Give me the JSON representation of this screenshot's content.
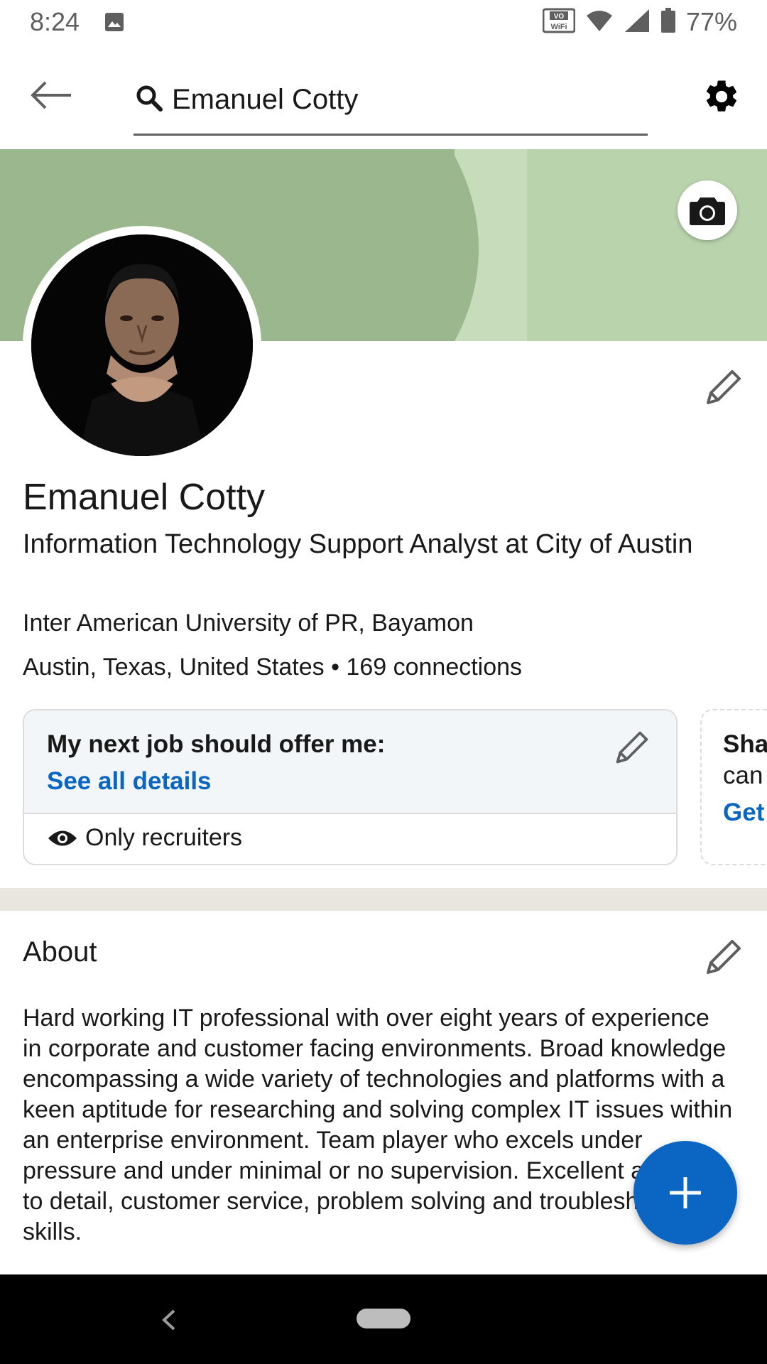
{
  "status_bar": {
    "time": "8:24",
    "battery": "77%",
    "icons": [
      "image-icon",
      "vowifi-icon",
      "wifi-icon",
      "signal-icon",
      "battery-icon"
    ]
  },
  "top_bar": {
    "back_icon": "arrow-left-icon",
    "search_value": "Emanuel Cotty",
    "settings_icon": "gear-icon"
  },
  "profile": {
    "name": "Emanuel Cotty",
    "headline": "Information Technology Support Analyst at City of Austin",
    "school": "Inter American University of PR, Bayamon",
    "location": "Austin, Texas, United States",
    "connections": "169 connections",
    "separator": "•"
  },
  "open_to_work_card": {
    "title": "My next job should offer me:",
    "link": "See all details",
    "visibility": "Only recruiters"
  },
  "second_card": {
    "title": "Sha",
    "subtitle": "can",
    "link": "Get"
  },
  "about": {
    "title": "About",
    "text": "Hard working IT professional with over eight years of experience in corporate and customer facing environments. Broad knowledge encompassing a wide variety of technologies and platforms with a keen aptitude for researching and solving complex IT issues within an enterprise environment. Team player who excels under pressure and under minimal or no supervision. Excellent attention to detail, customer service, problem solving and troubleshooting skills."
  },
  "colors": {
    "brand_blue": "#0a66c2",
    "banner_dark": "#9bb78d",
    "banner_light": "#b9d3ad",
    "divider": "#e9e5df"
  }
}
